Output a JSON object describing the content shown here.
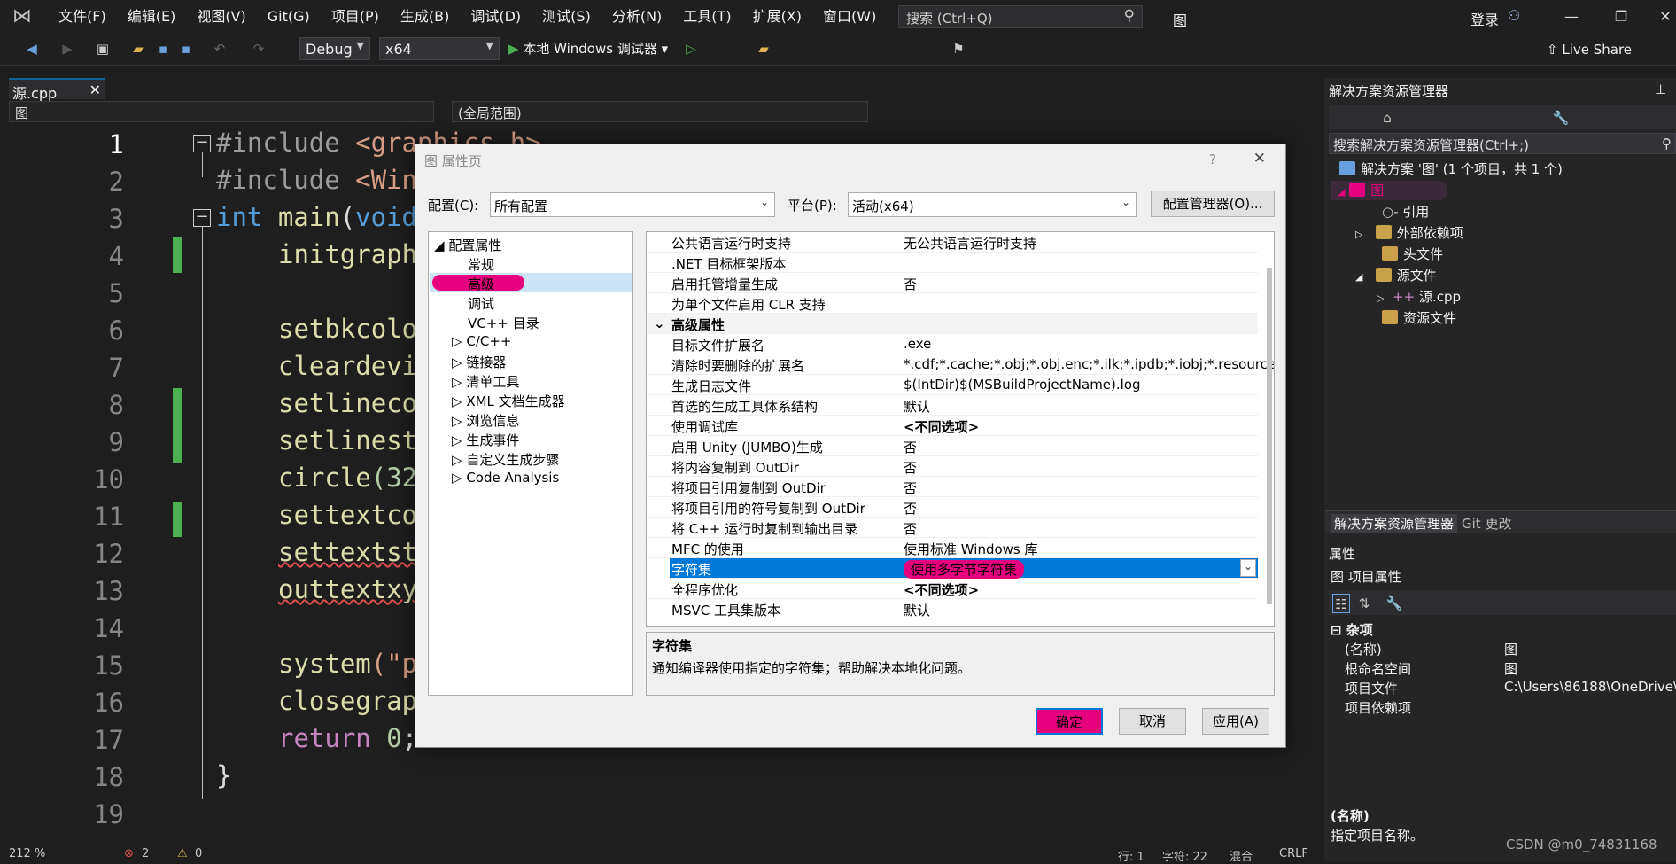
{
  "menu": [
    "文件(F)",
    "编辑(E)",
    "视图(V)",
    "Git(G)",
    "项目(P)",
    "生成(B)",
    "调试(D)",
    "测试(S)",
    "分析(N)",
    "工具(T)",
    "扩展(X)",
    "窗口(W)",
    "帮助(H)"
  ],
  "search": {
    "placeholder": "搜索 (Ctrl+Q)"
  },
  "window_title": "图",
  "login": "登录",
  "toolbar": {
    "config": "Debug",
    "platform": "x64",
    "debugger": "本地 Windows 调试器",
    "live_share": "Live Share"
  },
  "editor": {
    "tab": "源.cpp",
    "nav_left": "图",
    "nav_scope": "(全局范围)",
    "line_numbers": [
      "1",
      "2",
      "3",
      "4",
      "5",
      "6",
      "7",
      "8",
      "9",
      "10",
      "11",
      "12",
      "13",
      "14",
      "15",
      "16",
      "17",
      "18",
      "19"
    ],
    "lines": {
      "l1a": "#include ",
      "l1b": "<graphics.h>",
      "l2a": "#include ",
      "l2b": "<Win",
      "l3a": "int ",
      "l3b": "main",
      "l3c": "(",
      "l3d": "void",
      "l4": "initgraph",
      "l6": "setbkcolo",
      "l7": "cleardevi",
      "l8": "setlineco",
      "l9": "setlinest",
      "l10a": "circle",
      "l10b": "(32",
      "l11": "settextco",
      "l12": "settextst",
      "l13": "outtextxy",
      "l15a": "system",
      "l15b": "(\"p",
      "l16": "closegrap",
      "l17a": "return ",
      "l17b": "0",
      ";": ";",
      "l18": "}"
    }
  },
  "status": {
    "zoom": "212 %",
    "errors": "2",
    "warnings": "0",
    "line": "行: 1",
    "col": "字符: 22",
    "mix": "混合",
    "crlf": "CRLF"
  },
  "solution": {
    "title": "解决方案资源管理器",
    "search": "搜索解决方案资源管理器(Ctrl+;)",
    "root": "解决方案 '图' (1 个项目，共 1 个)",
    "project": "图",
    "items": [
      "引用",
      "外部依赖项",
      "头文件",
      "源文件",
      "源.cpp",
      "资源文件"
    ],
    "tabs": [
      "解决方案资源管理器",
      "Git 更改"
    ]
  },
  "properties": {
    "title": "属性",
    "subject": "图 项目属性",
    "category": "杂项",
    "rows": [
      {
        "k": "(名称)",
        "v": "图"
      },
      {
        "k": "根命名空间",
        "v": "图"
      },
      {
        "k": "项目文件",
        "v": "C:\\Users\\86188\\OneDrive\\"
      },
      {
        "k": "项目依赖项",
        "v": ""
      }
    ],
    "desc_title": "(名称)",
    "desc": "指定项目名称。"
  },
  "dialog": {
    "title": "图 属性页",
    "config_label": "配置(C):",
    "config_value": "所有配置",
    "platform_label": "平台(P):",
    "platform_value": "活动(x64)",
    "config_manager": "配置管理器(O)...",
    "tree": [
      "配置属性",
      "常规",
      "高级",
      "调试",
      "VC++ 目录",
      "C/C++",
      "链接器",
      "清单工具",
      "XML 文档生成器",
      "浏览信息",
      "生成事件",
      "自定义生成步骤",
      "Code Analysis"
    ],
    "rows": [
      {
        "k": "公共语言运行时支持",
        "v": "无公共语言运行时支持"
      },
      {
        "k": ".NET 目标框架版本",
        "v": ""
      },
      {
        "k": "启用托管增量生成",
        "v": "否"
      },
      {
        "k": "为单个文件启用 CLR 支持",
        "v": ""
      },
      {
        "k": "高级属性",
        "v": ""
      },
      {
        "k": "目标文件扩展名",
        "v": ".exe"
      },
      {
        "k": "清除时要删除的扩展名",
        "v": "*.cdf;*.cache;*.obj;*.obj.enc;*.ilk;*.ipdb;*.iobj;*.resource"
      },
      {
        "k": "生成日志文件",
        "v": "$(IntDir)$(MSBuildProjectName).log"
      },
      {
        "k": "首选的生成工具体系结构",
        "v": "默认"
      },
      {
        "k": "使用调试库",
        "v": "<不同选项>"
      },
      {
        "k": "启用 Unity (JUMBO)生成",
        "v": "否"
      },
      {
        "k": "将内容复制到 OutDir",
        "v": "否"
      },
      {
        "k": "将项目引用复制到 OutDir",
        "v": "否"
      },
      {
        "k": "将项目引用的符号复制到 OutDir",
        "v": "否"
      },
      {
        "k": "将 C++ 运行时复制到输出目录",
        "v": "否"
      },
      {
        "k": "MFC 的使用",
        "v": "使用标准 Windows 库"
      },
      {
        "k": "字符集",
        "v": "使用多字节字符集"
      },
      {
        "k": "全程序优化",
        "v": "<不同选项>"
      },
      {
        "k": "MSVC 工具集版本",
        "v": "默认"
      }
    ],
    "desc_title": "字符集",
    "desc": "通知编译器使用指定的字符集；帮助解决本地化问题。",
    "ok": "确定",
    "cancel": "取消",
    "apply": "应用(A)"
  },
  "watermark": "CSDN @m0_74831168",
  "colors": {
    "accent": "#0078d7",
    "highlight": "#e6007e",
    "green_change": "#4caf50"
  }
}
